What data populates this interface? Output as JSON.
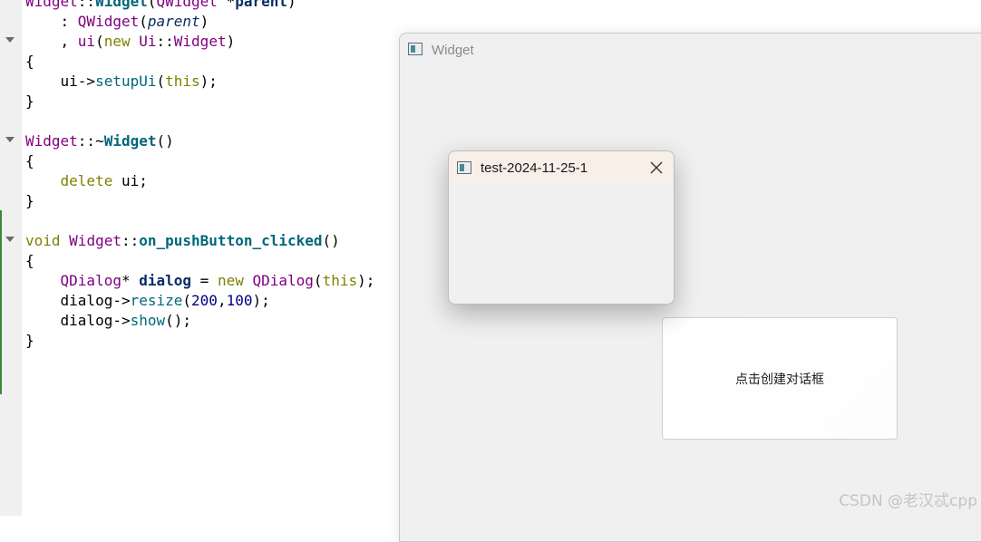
{
  "editor": {
    "lines": [
      [
        {
          "t": "Widget",
          "c": "ty"
        },
        {
          "t": "::",
          "c": "op"
        },
        {
          "t": "Widget",
          "c": "fnb"
        },
        {
          "t": "(",
          "c": "op"
        },
        {
          "t": "QWidget",
          "c": "ty"
        },
        {
          "t": " *",
          "c": "op"
        },
        {
          "t": "parent",
          "c": "pr"
        },
        {
          "t": ")",
          "c": "op"
        }
      ],
      [
        {
          "t": "    : ",
          "c": "op"
        },
        {
          "t": "QWidget",
          "c": "ty"
        },
        {
          "t": "(",
          "c": "op"
        },
        {
          "t": "parent",
          "c": "it"
        },
        {
          "t": ")",
          "c": "op"
        }
      ],
      [
        {
          "t": "    , ",
          "c": "op"
        },
        {
          "t": "ui",
          "c": "ty"
        },
        {
          "t": "(",
          "c": "op"
        },
        {
          "t": "new",
          "c": "kw"
        },
        {
          "t": " ",
          "c": "op"
        },
        {
          "t": "Ui",
          "c": "ty"
        },
        {
          "t": "::",
          "c": "op"
        },
        {
          "t": "Widget",
          "c": "ty"
        },
        {
          "t": ")",
          "c": "op"
        }
      ],
      [
        {
          "t": "{",
          "c": "op"
        }
      ],
      [
        {
          "t": "    ui->",
          "c": "op"
        },
        {
          "t": "setupUi",
          "c": "fn"
        },
        {
          "t": "(",
          "c": "op"
        },
        {
          "t": "this",
          "c": "kw"
        },
        {
          "t": ");",
          "c": "op"
        }
      ],
      [
        {
          "t": "}",
          "c": "op"
        }
      ],
      [],
      [
        {
          "t": "Widget",
          "c": "ty"
        },
        {
          "t": "::~",
          "c": "op"
        },
        {
          "t": "Widget",
          "c": "fnb"
        },
        {
          "t": "()",
          "c": "op"
        }
      ],
      [
        {
          "t": "{",
          "c": "op"
        }
      ],
      [
        {
          "t": "    ",
          "c": "op"
        },
        {
          "t": "delete",
          "c": "kw"
        },
        {
          "t": " ui;",
          "c": "op"
        }
      ],
      [
        {
          "t": "}",
          "c": "op"
        }
      ],
      [],
      [
        {
          "t": "void",
          "c": "kw"
        },
        {
          "t": " ",
          "c": "op"
        },
        {
          "t": "Widget",
          "c": "ty"
        },
        {
          "t": "::",
          "c": "op"
        },
        {
          "t": "on_pushButton_clicked",
          "c": "fnb"
        },
        {
          "t": "()",
          "c": "op"
        }
      ],
      [
        {
          "t": "{",
          "c": "op"
        }
      ],
      [
        {
          "t": "    ",
          "c": "op"
        },
        {
          "t": "QDialog",
          "c": "ty"
        },
        {
          "t": "* ",
          "c": "op"
        },
        {
          "t": "dialog",
          "c": "pr"
        },
        {
          "t": " = ",
          "c": "op"
        },
        {
          "t": "new",
          "c": "kw"
        },
        {
          "t": " ",
          "c": "op"
        },
        {
          "t": "QDialog",
          "c": "ty"
        },
        {
          "t": "(",
          "c": "op"
        },
        {
          "t": "this",
          "c": "kw"
        },
        {
          "t": ");",
          "c": "op"
        }
      ],
      [
        {
          "t": "    dialog->",
          "c": "op"
        },
        {
          "t": "resize",
          "c": "fn"
        },
        {
          "t": "(",
          "c": "op"
        },
        {
          "t": "200",
          "c": "nm"
        },
        {
          "t": ",",
          "c": "op"
        },
        {
          "t": "100",
          "c": "nm"
        },
        {
          "t": ");",
          "c": "op"
        }
      ],
      [
        {
          "t": "    dialog->",
          "c": "op"
        },
        {
          "t": "show",
          "c": "fn"
        },
        {
          "t": "();",
          "c": "op"
        }
      ],
      [
        {
          "t": "}",
          "c": "op"
        }
      ]
    ]
  },
  "main_window": {
    "title": "Widget",
    "icon": "window-app-icon",
    "button_label": "点击创建对话框"
  },
  "dialog": {
    "title": "test-2024-11-25-1",
    "icon": "window-app-icon",
    "close_icon": "close-icon"
  },
  "watermark": "CSDN @老汉忒cpp",
  "colors": {
    "keyword": "#808000",
    "type": "#800080",
    "function": "#00677c",
    "parameter": "#092e64",
    "number": "#000080",
    "dialog_titlebar": "#f7efe8",
    "window_bg": "#f0f0f0"
  }
}
